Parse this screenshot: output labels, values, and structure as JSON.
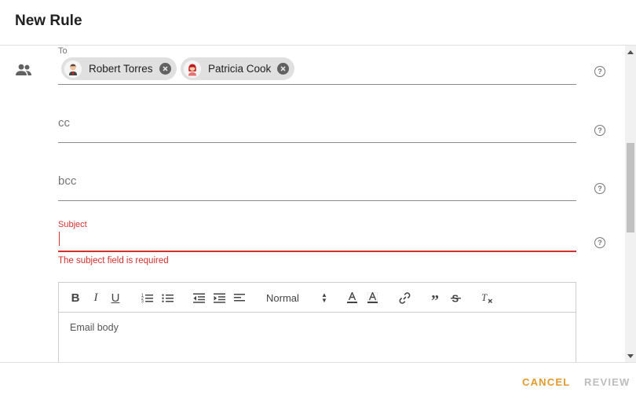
{
  "dialog": {
    "title": "New Rule"
  },
  "to_field": {
    "label": "To",
    "recipients": [
      {
        "name": "Robert Torres",
        "avatar": "man-avatar-icon"
      },
      {
        "name": "Patricia Cook",
        "avatar": "woman-avatar-icon"
      }
    ]
  },
  "cc_field": {
    "placeholder": "cc"
  },
  "bcc_field": {
    "placeholder": "bcc"
  },
  "subject_field": {
    "label": "Subject",
    "value": "",
    "error": "The subject field is required"
  },
  "editor": {
    "toolbar": {
      "buttons": [
        "bold-icon",
        "italic-icon",
        "underline-icon",
        "ordered-list-icon",
        "bullet-list-icon",
        "outdent-icon",
        "indent-icon",
        "align-icon",
        "text-color-icon",
        "background-color-icon",
        "link-icon",
        "blockquote-icon",
        "strikethrough-icon",
        "clear-format-icon"
      ],
      "font_size": "Normal"
    },
    "body_placeholder": "Email body"
  },
  "actions": {
    "cancel": "CANCEL",
    "review": "REVIEW"
  },
  "colors": {
    "accent": "#e49a2c",
    "error": "#d32f2f",
    "disabled": "#bdbdbd"
  }
}
